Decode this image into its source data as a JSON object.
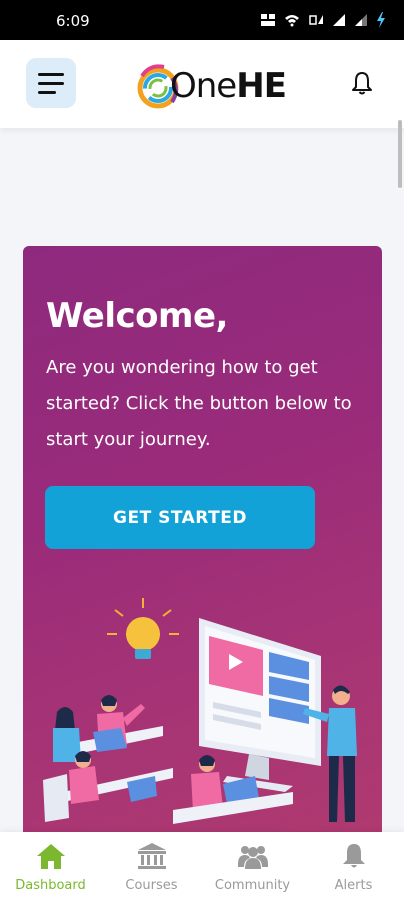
{
  "status_bar": {
    "time": "6:09",
    "icons": [
      "data-speed-icon",
      "wifi-icon",
      "volte-icon",
      "signal-icon",
      "signal-icon",
      "battery-charging-icon"
    ]
  },
  "header": {
    "menu_icon": "hamburger-menu-icon",
    "logo_text_light": "One",
    "logo_text_bold": "HE",
    "notification_icon": "bell-icon"
  },
  "welcome": {
    "title": "Welcome,",
    "body": "Are you wondering how to get started? Click the button below to start your journey.",
    "button_label": "GET STARTED"
  },
  "bottom_nav": {
    "items": [
      {
        "label": "Dashboard",
        "icon": "home-icon",
        "active": true
      },
      {
        "label": "Courses",
        "icon": "institution-icon",
        "active": false
      },
      {
        "label": "Community",
        "icon": "people-icon",
        "active": false
      },
      {
        "label": "Alerts",
        "icon": "bell-icon",
        "active": false
      }
    ]
  },
  "colors": {
    "accent_green": "#7cb82f",
    "cta_blue": "#13a2d8",
    "card_purple": "#9a2b7a"
  }
}
